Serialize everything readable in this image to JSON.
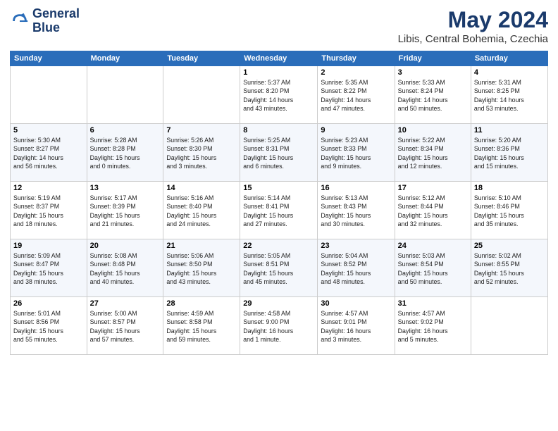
{
  "header": {
    "logo_line1": "General",
    "logo_line2": "Blue",
    "month_year": "May 2024",
    "location": "Libis, Central Bohemia, Czechia"
  },
  "days_of_week": [
    "Sunday",
    "Monday",
    "Tuesday",
    "Wednesday",
    "Thursday",
    "Friday",
    "Saturday"
  ],
  "weeks": [
    [
      {
        "day": "",
        "info": ""
      },
      {
        "day": "",
        "info": ""
      },
      {
        "day": "",
        "info": ""
      },
      {
        "day": "1",
        "info": "Sunrise: 5:37 AM\nSunset: 8:20 PM\nDaylight: 14 hours\nand 43 minutes."
      },
      {
        "day": "2",
        "info": "Sunrise: 5:35 AM\nSunset: 8:22 PM\nDaylight: 14 hours\nand 47 minutes."
      },
      {
        "day": "3",
        "info": "Sunrise: 5:33 AM\nSunset: 8:24 PM\nDaylight: 14 hours\nand 50 minutes."
      },
      {
        "day": "4",
        "info": "Sunrise: 5:31 AM\nSunset: 8:25 PM\nDaylight: 14 hours\nand 53 minutes."
      }
    ],
    [
      {
        "day": "5",
        "info": "Sunrise: 5:30 AM\nSunset: 8:27 PM\nDaylight: 14 hours\nand 56 minutes."
      },
      {
        "day": "6",
        "info": "Sunrise: 5:28 AM\nSunset: 8:28 PM\nDaylight: 15 hours\nand 0 minutes."
      },
      {
        "day": "7",
        "info": "Sunrise: 5:26 AM\nSunset: 8:30 PM\nDaylight: 15 hours\nand 3 minutes."
      },
      {
        "day": "8",
        "info": "Sunrise: 5:25 AM\nSunset: 8:31 PM\nDaylight: 15 hours\nand 6 minutes."
      },
      {
        "day": "9",
        "info": "Sunrise: 5:23 AM\nSunset: 8:33 PM\nDaylight: 15 hours\nand 9 minutes."
      },
      {
        "day": "10",
        "info": "Sunrise: 5:22 AM\nSunset: 8:34 PM\nDaylight: 15 hours\nand 12 minutes."
      },
      {
        "day": "11",
        "info": "Sunrise: 5:20 AM\nSunset: 8:36 PM\nDaylight: 15 hours\nand 15 minutes."
      }
    ],
    [
      {
        "day": "12",
        "info": "Sunrise: 5:19 AM\nSunset: 8:37 PM\nDaylight: 15 hours\nand 18 minutes."
      },
      {
        "day": "13",
        "info": "Sunrise: 5:17 AM\nSunset: 8:39 PM\nDaylight: 15 hours\nand 21 minutes."
      },
      {
        "day": "14",
        "info": "Sunrise: 5:16 AM\nSunset: 8:40 PM\nDaylight: 15 hours\nand 24 minutes."
      },
      {
        "day": "15",
        "info": "Sunrise: 5:14 AM\nSunset: 8:41 PM\nDaylight: 15 hours\nand 27 minutes."
      },
      {
        "day": "16",
        "info": "Sunrise: 5:13 AM\nSunset: 8:43 PM\nDaylight: 15 hours\nand 30 minutes."
      },
      {
        "day": "17",
        "info": "Sunrise: 5:12 AM\nSunset: 8:44 PM\nDaylight: 15 hours\nand 32 minutes."
      },
      {
        "day": "18",
        "info": "Sunrise: 5:10 AM\nSunset: 8:46 PM\nDaylight: 15 hours\nand 35 minutes."
      }
    ],
    [
      {
        "day": "19",
        "info": "Sunrise: 5:09 AM\nSunset: 8:47 PM\nDaylight: 15 hours\nand 38 minutes."
      },
      {
        "day": "20",
        "info": "Sunrise: 5:08 AM\nSunset: 8:48 PM\nDaylight: 15 hours\nand 40 minutes."
      },
      {
        "day": "21",
        "info": "Sunrise: 5:06 AM\nSunset: 8:50 PM\nDaylight: 15 hours\nand 43 minutes."
      },
      {
        "day": "22",
        "info": "Sunrise: 5:05 AM\nSunset: 8:51 PM\nDaylight: 15 hours\nand 45 minutes."
      },
      {
        "day": "23",
        "info": "Sunrise: 5:04 AM\nSunset: 8:52 PM\nDaylight: 15 hours\nand 48 minutes."
      },
      {
        "day": "24",
        "info": "Sunrise: 5:03 AM\nSunset: 8:54 PM\nDaylight: 15 hours\nand 50 minutes."
      },
      {
        "day": "25",
        "info": "Sunrise: 5:02 AM\nSunset: 8:55 PM\nDaylight: 15 hours\nand 52 minutes."
      }
    ],
    [
      {
        "day": "26",
        "info": "Sunrise: 5:01 AM\nSunset: 8:56 PM\nDaylight: 15 hours\nand 55 minutes."
      },
      {
        "day": "27",
        "info": "Sunrise: 5:00 AM\nSunset: 8:57 PM\nDaylight: 15 hours\nand 57 minutes."
      },
      {
        "day": "28",
        "info": "Sunrise: 4:59 AM\nSunset: 8:58 PM\nDaylight: 15 hours\nand 59 minutes."
      },
      {
        "day": "29",
        "info": "Sunrise: 4:58 AM\nSunset: 9:00 PM\nDaylight: 16 hours\nand 1 minute."
      },
      {
        "day": "30",
        "info": "Sunrise: 4:57 AM\nSunset: 9:01 PM\nDaylight: 16 hours\nand 3 minutes."
      },
      {
        "day": "31",
        "info": "Sunrise: 4:57 AM\nSunset: 9:02 PM\nDaylight: 16 hours\nand 5 minutes."
      },
      {
        "day": "",
        "info": ""
      }
    ]
  ]
}
